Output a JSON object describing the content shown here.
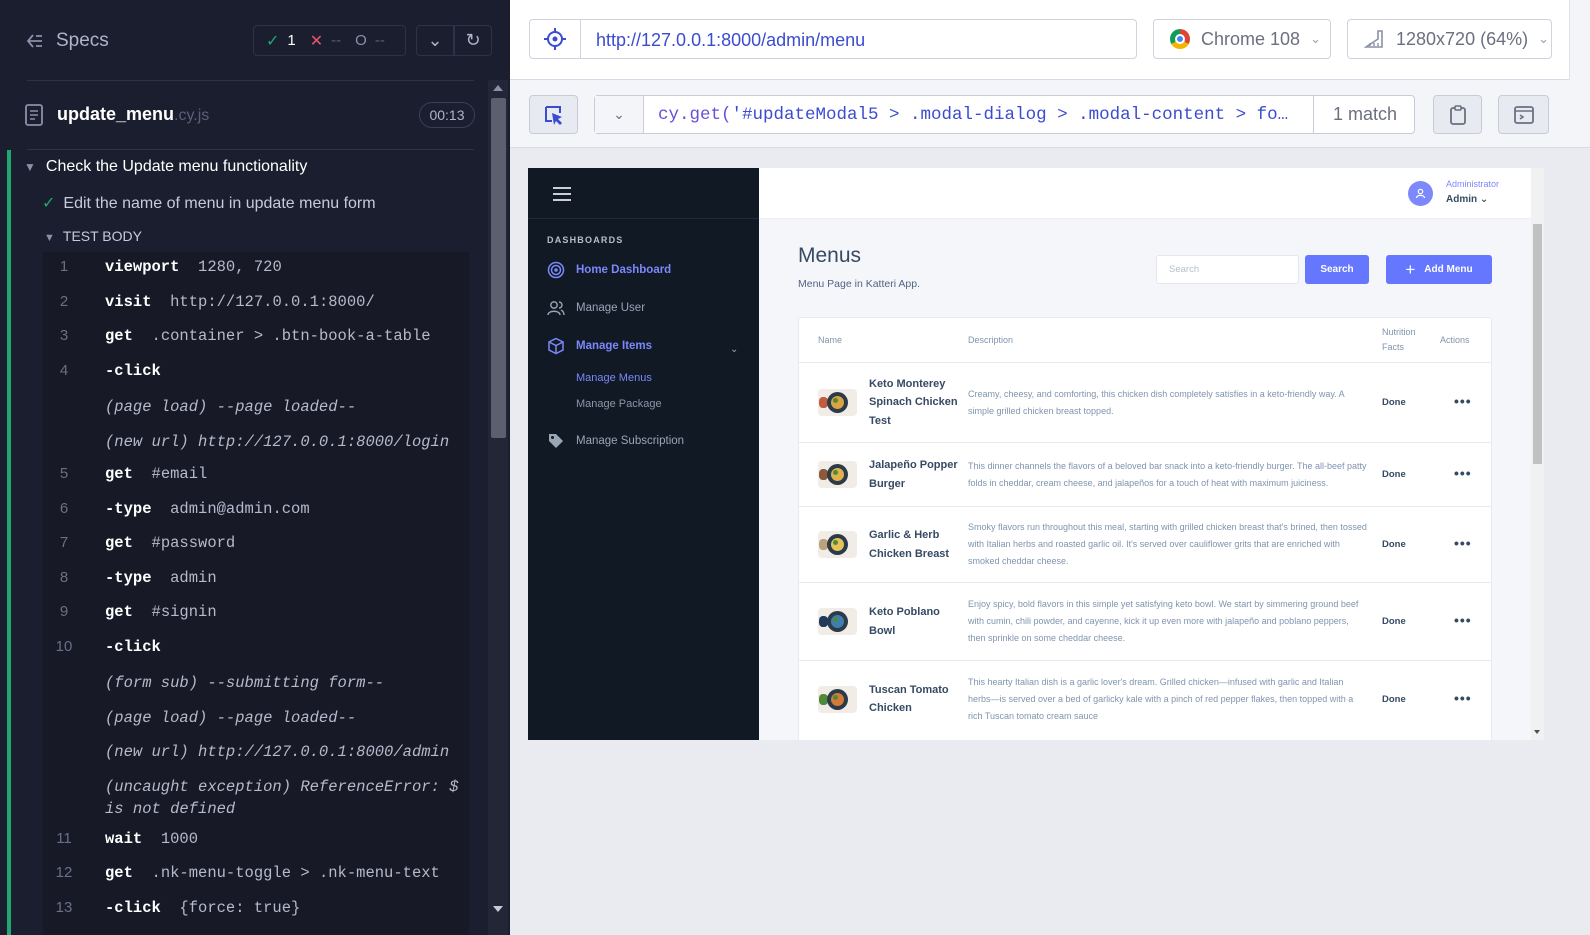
{
  "reporter": {
    "specs_label": "Specs",
    "stats": {
      "passed": "1",
      "failed": "--",
      "pending": "--"
    },
    "spec_file": {
      "name": "update_menu",
      "ext": ".cy.js",
      "duration": "00:13"
    },
    "suite_title": "Check the Update menu functionality",
    "test_title": "Edit the name of menu in update menu form",
    "test_body_label": "TEST BODY",
    "commands": [
      {
        "num": "1",
        "name": "viewport",
        "message": "1280, 720"
      },
      {
        "num": "2",
        "name": "visit",
        "message": "http://127.0.0.1:8000/"
      },
      {
        "num": "3",
        "name": "get",
        "message": ".container > .btn-book-a-table"
      },
      {
        "num": "4",
        "name": "-click",
        "message": ""
      },
      {
        "num": "",
        "event": "(page load)  --page loaded--"
      },
      {
        "num": "",
        "event": "(new url)  http://127.0.0.1:8000/login"
      },
      {
        "num": "5",
        "name": "get",
        "message": "#email"
      },
      {
        "num": "6",
        "name": "-type",
        "message": "admin@admin.com"
      },
      {
        "num": "7",
        "name": "get",
        "message": "#password"
      },
      {
        "num": "8",
        "name": "-type",
        "message": "admin"
      },
      {
        "num": "9",
        "name": "get",
        "message": "#signin"
      },
      {
        "num": "10",
        "name": "-click",
        "message": ""
      },
      {
        "num": "",
        "event": "(form sub)  --submitting form--"
      },
      {
        "num": "",
        "event": "(page load)  --page loaded--"
      },
      {
        "num": "",
        "event": "(new url)  http://127.0.0.1:8000/admin"
      },
      {
        "num": "",
        "event": "(uncaught exception)  ReferenceError: $ is not defined"
      },
      {
        "num": "11",
        "name": "wait",
        "message": "1000"
      },
      {
        "num": "12",
        "name": "get",
        "message": ".nk-menu-toggle > .nk-menu-text"
      },
      {
        "num": "13",
        "name": "-click",
        "message": "{force: true}"
      }
    ]
  },
  "aut": {
    "url": "http://127.0.0.1:8000/admin/menu",
    "browser": "Chrome 108",
    "viewport": "1280x720 (64%)",
    "selector_fn": "cy.get(",
    "selector_str": "'#updateModal5 > .modal-dialog > .modal-content > fo…",
    "match_count": "1 match"
  },
  "app": {
    "sidebar": {
      "heading": "DASHBOARDS",
      "items": [
        {
          "label": "Home Dashboard",
          "icon": "dashboard-icon",
          "active": true
        },
        {
          "label": "Manage User",
          "icon": "users-icon",
          "active": false
        },
        {
          "label": "Manage Items",
          "icon": "box-icon",
          "active": true
        },
        {
          "label": "Manage Subscription",
          "icon": "tag-icon",
          "active": false
        }
      ],
      "sub_items": [
        "Manage Menus",
        "Manage Package"
      ]
    },
    "user": {
      "role": "Administrator",
      "name": "Admin"
    },
    "page": {
      "title": "Menus",
      "subtitle": "Menu Page in Katteri App.",
      "search_placeholder": "Search",
      "search_button": "Search",
      "add_button": "Add Menu"
    },
    "table": {
      "headers": {
        "name": "Name",
        "description": "Description",
        "nutrition": "Nutrition Facts",
        "actions": "Actions"
      },
      "rows": [
        {
          "name": "Keto Monterey Spinach Chicken Test",
          "description": "Creamy, cheesy, and comforting, this chicken dish completely satisfies in a keto-friendly way. A simple grilled chicken breast topped.",
          "nutrition": "Done"
        },
        {
          "name": "Jalapeño Popper Burger",
          "description": "This dinner channels the flavors of a beloved bar snack into a keto-friendly burger. The all-beef patty folds in cheddar, cream cheese, and jalapeños for a touch of heat with maximum juiciness.",
          "nutrition": "Done"
        },
        {
          "name": "Garlic & Herb Chicken Breast",
          "description": "Smoky flavors run throughout this meal, starting with grilled chicken breast that's brined, then tossed with Italian herbs and roasted garlic oil. It's served over cauliflower grits that are enriched with smoked cheddar cheese.",
          "nutrition": "Done"
        },
        {
          "name": "Keto Poblano Bowl",
          "description": "Enjoy spicy, bold flavors in this simple yet satisfying keto bowl. We start by simmering ground beef with cumin, chili powder, and cayenne, kick it up even more with jalapeño and poblano peppers, then sprinkle on some cheddar cheese.",
          "nutrition": "Done"
        },
        {
          "name": "Tuscan Tomato Chicken",
          "description": "This hearty Italian dish is a garlic lover's dream. Grilled chicken—infused with garlic and Italian herbs—is served over a bed of garlicky kale with a pinch of red pepper flakes, then topped with a rich Tuscan tomato cream sauce",
          "nutrition": "Done"
        }
      ]
    }
  }
}
